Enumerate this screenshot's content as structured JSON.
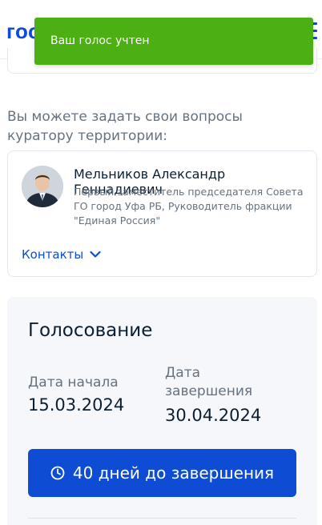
{
  "header": {
    "logo_text": "гос"
  },
  "toast": {
    "message": "Ваш голос учтен"
  },
  "ask_curator": {
    "text": "Вы можете задать свои вопросы куратору территории:"
  },
  "curator": {
    "name": "Мельников Александр Геннадиевич",
    "role": "Первый заместитель председателя Совета ГО город Уфа РБ, Руководитель фракции \"Единая Россия\"",
    "contacts_label": "Контакты"
  },
  "voting": {
    "title": "Голосование",
    "start_label": "Дата начала",
    "start_date": "15.03.2024",
    "end_label": "Дата завершения",
    "end_date": "30.04.2024",
    "days_left_label": "40 дней до завершения"
  },
  "colors": {
    "accent": "#0d4cd3",
    "toast_bg": "#4caf13",
    "card_bg": "#f5f7fa"
  }
}
